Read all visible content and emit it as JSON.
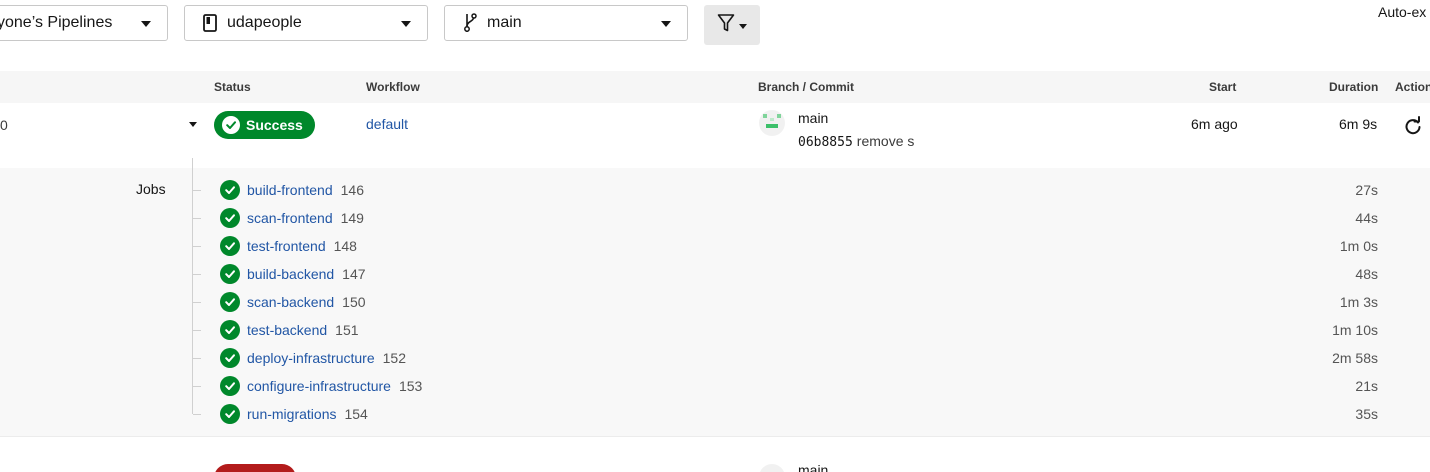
{
  "filters": {
    "pipelines_label": "yone’s Pipelines",
    "project_label": "udapeople",
    "branch_label": "main",
    "auto_expand_label": "Auto-ex"
  },
  "table": {
    "headers": {
      "status": "Status",
      "workflow": "Workflow",
      "branch_commit": "Branch / Commit",
      "start": "Start",
      "duration": "Duration",
      "actions": "Action"
    }
  },
  "pipeline": {
    "number_fragment": "0",
    "status": "Success",
    "workflow": "default",
    "branch": "main",
    "commit_sha": "06b8855",
    "commit_message": "remove s",
    "start": "6m ago",
    "duration": "6m 9s",
    "status_color": "#00882b"
  },
  "jobs_label": "Jobs",
  "jobs": [
    {
      "name": "build-frontend",
      "number": "146",
      "duration": "27s"
    },
    {
      "name": "scan-frontend",
      "number": "149",
      "duration": "44s"
    },
    {
      "name": "test-frontend",
      "number": "148",
      "duration": "1m 0s"
    },
    {
      "name": "build-backend",
      "number": "147",
      "duration": "48s"
    },
    {
      "name": "scan-backend",
      "number": "150",
      "duration": "1m 3s"
    },
    {
      "name": "test-backend",
      "number": "151",
      "duration": "1m 10s"
    },
    {
      "name": "deploy-infrastructure",
      "number": "152",
      "duration": "2m 58s"
    },
    {
      "name": "configure-infrastructure",
      "number": "153",
      "duration": "21s"
    },
    {
      "name": "run-migrations",
      "number": "154",
      "duration": "35s"
    }
  ],
  "next_pipeline": {
    "branch": "main",
    "status_color": "#b31b1b"
  },
  "icons": {
    "project": "bookmark-icon",
    "branch": "git-branch-icon",
    "filter": "filter-icon",
    "rerun": "rerun-icon",
    "job_status": "check-circle-icon"
  }
}
